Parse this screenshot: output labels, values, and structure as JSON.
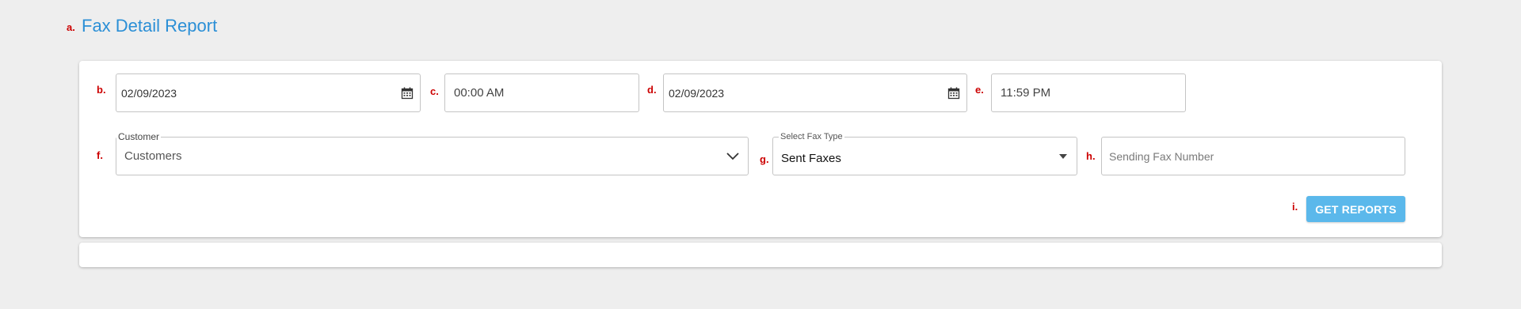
{
  "markers": {
    "a": "a.",
    "b": "b.",
    "c": "c.",
    "d": "d.",
    "e": "e.",
    "f": "f.",
    "g": "g.",
    "h": "h.",
    "i": "i."
  },
  "page": {
    "title": "Fax Detail Report"
  },
  "filters": {
    "start_date": "02/09/2023",
    "start_time": "00:00 AM",
    "end_date": "02/09/2023",
    "end_time": "11:59 PM",
    "customer": {
      "label": "Customer",
      "value": "Customers"
    },
    "fax_type": {
      "label": "Select Fax Type",
      "value": "Sent Faxes"
    },
    "sending_fax_number": {
      "placeholder": "Sending Fax Number"
    }
  },
  "actions": {
    "get_reports_label": "GET REPORTS"
  },
  "colors": {
    "accent": "#2b8fd6",
    "button": "#5bb8eb",
    "marker": "#cc0000",
    "background": "#eeeeee"
  },
  "icons": {
    "calendar": "calendar-icon",
    "customer_dropdown": "chevron-down-icon",
    "fax_type_dropdown": "caret-down-icon"
  }
}
